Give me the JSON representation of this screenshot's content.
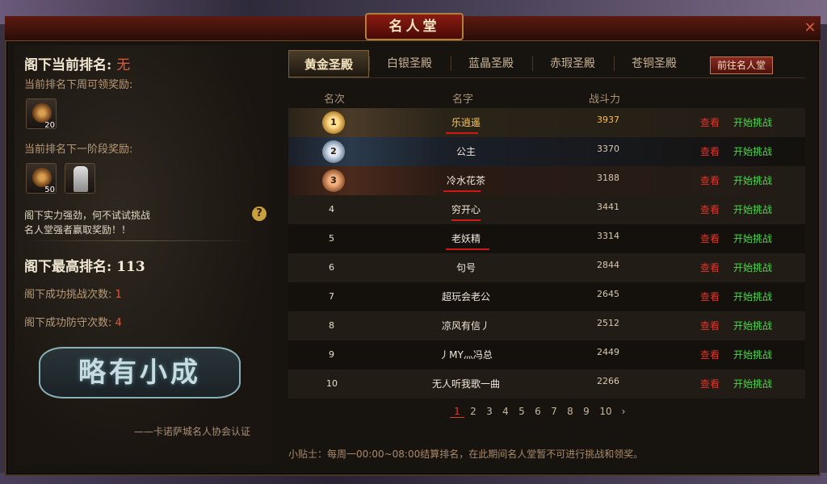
{
  "window": {
    "title": "名人堂"
  },
  "left": {
    "current_rank_label": "阁下当前排名:",
    "current_rank_value": "无",
    "weekly_reward_label": "当前排名下周可领奖励:",
    "weekly_reward_item_count": "20",
    "stage_reward_label": "当前排名下一阶段奖励:",
    "stage_reward_item_count": "50",
    "encourage_line1": "阁下实力强劲，何不试试挑战",
    "encourage_line2": "名人堂强者赢取奖励！！",
    "best_rank_label": "阁下最高排名:",
    "best_rank_value": "113",
    "challenge_success_label": "阁下成功挑战次数:",
    "challenge_success_value": "1",
    "defense_success_label": "阁下成功防守次数:",
    "defense_success_value": "4",
    "title_badge": "略有小成",
    "certification": "——卡诺萨城名人协会认证"
  },
  "tabs": [
    "黄金圣殿",
    "白银圣殿",
    "蓝晶圣殿",
    "赤瑕圣殿",
    "苍铜圣殿"
  ],
  "active_tab": 0,
  "goto_button": "前往名人堂",
  "columns": {
    "rank": "名次",
    "name": "名字",
    "power": "战斗力"
  },
  "rows": [
    {
      "rank": "1",
      "name": "乐逍遥",
      "power": "3937"
    },
    {
      "rank": "2",
      "name": "公主",
      "power": "3370"
    },
    {
      "rank": "3",
      "name": "冷水花茶",
      "power": "3188"
    },
    {
      "rank": "4",
      "name": "穷开心",
      "power": "3441"
    },
    {
      "rank": "5",
      "name": "老妖精",
      "power": "3314"
    },
    {
      "rank": "6",
      "name": "句号",
      "power": "2844"
    },
    {
      "rank": "7",
      "name": "超玩会老公",
      "power": "2645"
    },
    {
      "rank": "8",
      "name": "凉风有信丿",
      "power": "2512"
    },
    {
      "rank": "9",
      "name": "丿MY灬冯总",
      "power": "2449"
    },
    {
      "rank": "10",
      "name": "无人听我歌一曲",
      "power": "2266"
    }
  ],
  "row_actions": {
    "view": "查看",
    "challenge": "开始挑战"
  },
  "pager": {
    "pages": [
      "1",
      "2",
      "3",
      "4",
      "5",
      "6",
      "7",
      "8",
      "9",
      "10"
    ],
    "current": "1",
    "next": "›"
  },
  "tip": "小贴士：每周一00:00~08:00结算排名，在此期间名人堂暂不可进行挑战和领奖。",
  "close_icon": "close-icon"
}
